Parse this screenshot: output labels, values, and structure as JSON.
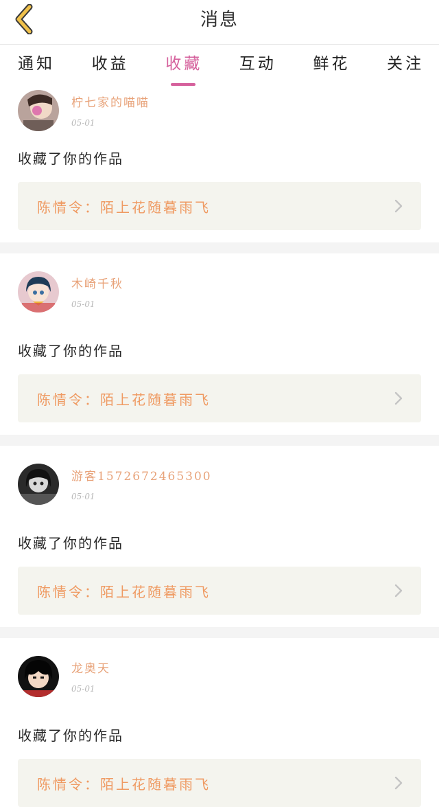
{
  "header": {
    "title": "消息",
    "back_icon": "chevron-left-icon"
  },
  "tabs": [
    {
      "label": "通知",
      "active": false
    },
    {
      "label": "收益",
      "active": false
    },
    {
      "label": "收藏",
      "active": true
    },
    {
      "label": "互动",
      "active": false
    },
    {
      "label": "鲜花",
      "active": false
    },
    {
      "label": "关注",
      "active": false
    }
  ],
  "items": [
    {
      "username": "柠七家的喵喵",
      "date": "05-01",
      "action": "收藏了你的作品",
      "work_title": "陈情令：陌上花随暮雨飞"
    },
    {
      "username": "木崎千秋",
      "date": "05-01",
      "action": "收藏了你的作品",
      "work_title": "陈情令：陌上花随暮雨飞"
    },
    {
      "username": "游客1572672465300",
      "date": "05-01",
      "action": "收藏了你的作品",
      "work_title": "陈情令：陌上花随暮雨飞"
    },
    {
      "username": "龙奥天",
      "date": "05-01",
      "action": "收藏了你的作品",
      "work_title": "陈情令：陌上花随暮雨飞"
    }
  ],
  "colors": {
    "active_tab": "#d5609c",
    "username": "#e8a37a",
    "work_title": "#ef9a62",
    "work_bg": "#f4f4ee",
    "back_icon": "#f0c14b"
  }
}
